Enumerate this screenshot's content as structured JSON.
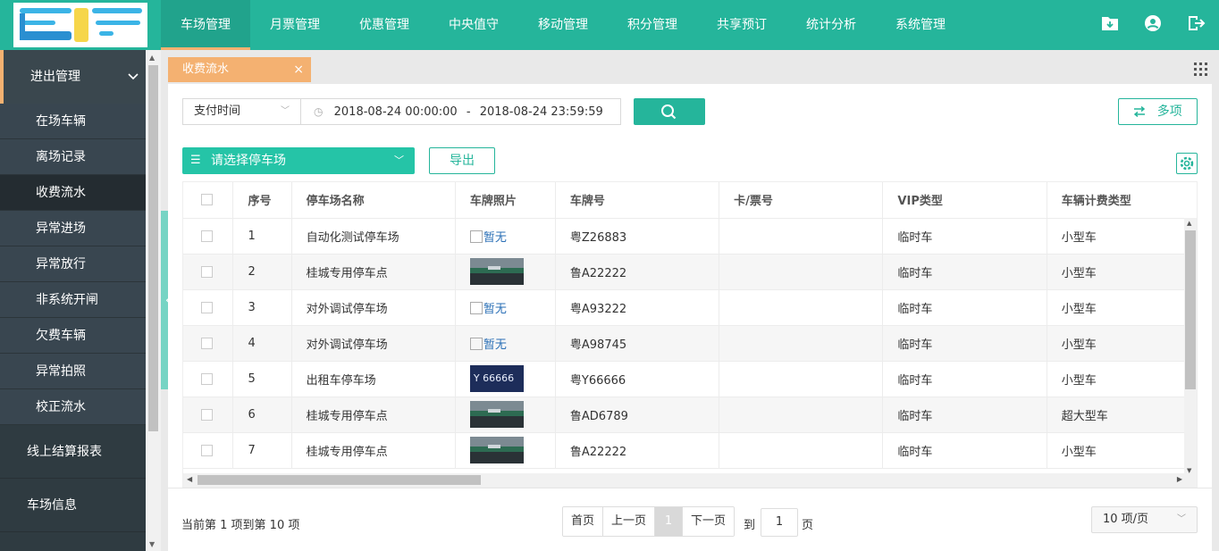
{
  "header": {
    "nav": [
      "车场管理",
      "月票管理",
      "优惠管理",
      "中央值守",
      "移动管理",
      "积分管理",
      "共享预订",
      "统计分析",
      "系统管理"
    ],
    "active_nav": 0,
    "icons": [
      "download-folder-icon",
      "user-icon",
      "logout-icon"
    ]
  },
  "sidebar": {
    "group_label": "进出管理",
    "sub_items": [
      "在场车辆",
      "离场记录",
      "收费流水",
      "异常进场",
      "异常放行",
      "非系统开闸",
      "欠费车辆",
      "异常拍照",
      "校正流水"
    ],
    "active_sub": 2,
    "main_items": [
      "线上结算报表",
      "车场信息"
    ]
  },
  "tab": {
    "label": "收费流水",
    "close": "×"
  },
  "filters": {
    "time_type": "支付时间",
    "date_from": "2018-08-24 00:00:00",
    "date_sep": "-",
    "date_to": "2018-08-24 23:59:59",
    "multi_label": "多项",
    "lot_placeholder": "请选择停车场",
    "export_label": "导出"
  },
  "table": {
    "columns": [
      "序号",
      "停车场名称",
      "车牌照片",
      "车牌号",
      "卡/票号",
      "VIP类型",
      "车辆计费类型"
    ],
    "rows": [
      {
        "no": "1",
        "lot": "自动化测试停车场",
        "photo": "none",
        "plate": "粤Z26883",
        "card": "",
        "vip": "临时车",
        "billing": "小型车"
      },
      {
        "no": "2",
        "lot": "桂城专用停车点",
        "photo": "road",
        "plate": "鲁A22222",
        "card": "",
        "vip": "临时车",
        "billing": "小型车"
      },
      {
        "no": "3",
        "lot": "对外调试停车场",
        "photo": "none",
        "plate": "粤A93222",
        "card": "",
        "vip": "临时车",
        "billing": "小型车"
      },
      {
        "no": "4",
        "lot": "对外调试停车场",
        "photo": "none",
        "plate": "粤A98745",
        "card": "",
        "vip": "临时车",
        "billing": "小型车"
      },
      {
        "no": "5",
        "lot": "出租车停车场",
        "photo": "plate",
        "plate": "粤Y66666",
        "card": "",
        "vip": "临时车",
        "billing": "小型车"
      },
      {
        "no": "6",
        "lot": "桂城专用停车点",
        "photo": "road",
        "plate": "鲁AD6789",
        "card": "",
        "vip": "临时车",
        "billing": "超大型车"
      },
      {
        "no": "7",
        "lot": "桂城专用停车点",
        "photo": "road",
        "plate": "鲁A22222",
        "card": "",
        "vip": "临时车",
        "billing": "小型车"
      }
    ],
    "no_image_text": "暂无",
    "plate_image_text": "Y 66666"
  },
  "footer": {
    "info": "当前第 1 项到第 10 项",
    "first": "首页",
    "prev": "上一页",
    "current": "1",
    "next": "下一页",
    "goto_prefix": "到",
    "goto_value": "1",
    "goto_suffix": "页",
    "page_size": "10 项/页"
  },
  "colors": {
    "primary": "#25b59b",
    "accent": "#f4b171",
    "sidebar": "#2f3b41"
  }
}
